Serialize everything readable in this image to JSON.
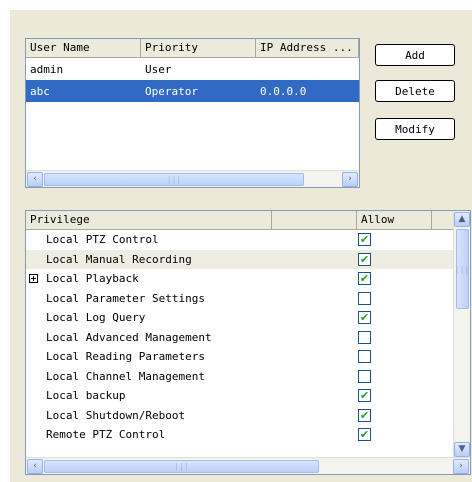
{
  "users": {
    "columns": [
      "User Name",
      "Priority",
      "IP Address ..."
    ],
    "rows": [
      {
        "name": "admin",
        "priority": "User",
        "ip": "",
        "selected": false
      },
      {
        "name": "abc",
        "priority": "Operator",
        "ip": "0.0.0.0",
        "selected": true
      }
    ]
  },
  "buttons": {
    "add": "Add",
    "delete": "Delete",
    "modify": "Modify"
  },
  "privileges": {
    "columns": [
      "Privilege",
      "",
      "Allow"
    ],
    "rows": [
      {
        "name": "Local PTZ Control",
        "allow": true
      },
      {
        "name": "Local Manual Recording",
        "allow": true
      },
      {
        "name": "Local Playback",
        "allow": true
      },
      {
        "name": "Local Parameter Settings",
        "allow": false
      },
      {
        "name": "Local Log Query",
        "allow": true
      },
      {
        "name": "Local Advanced Management",
        "allow": false
      },
      {
        "name": "Local Reading Parameters",
        "allow": false
      },
      {
        "name": "Local Channel Management",
        "allow": false
      },
      {
        "name": "Local backup",
        "allow": true
      },
      {
        "name": "Local Shutdown/Reboot",
        "allow": true
      },
      {
        "name": "Remote PTZ Control",
        "allow": true
      }
    ]
  },
  "scrollbar": {
    "left": "‹",
    "right": "›",
    "up": "▲",
    "down": "▼",
    "grip": "|||"
  },
  "icons": {
    "check": "✔"
  },
  "colors": {
    "selection": "#316ac5",
    "check": "#21a121",
    "dialog": "#ece9d8"
  }
}
